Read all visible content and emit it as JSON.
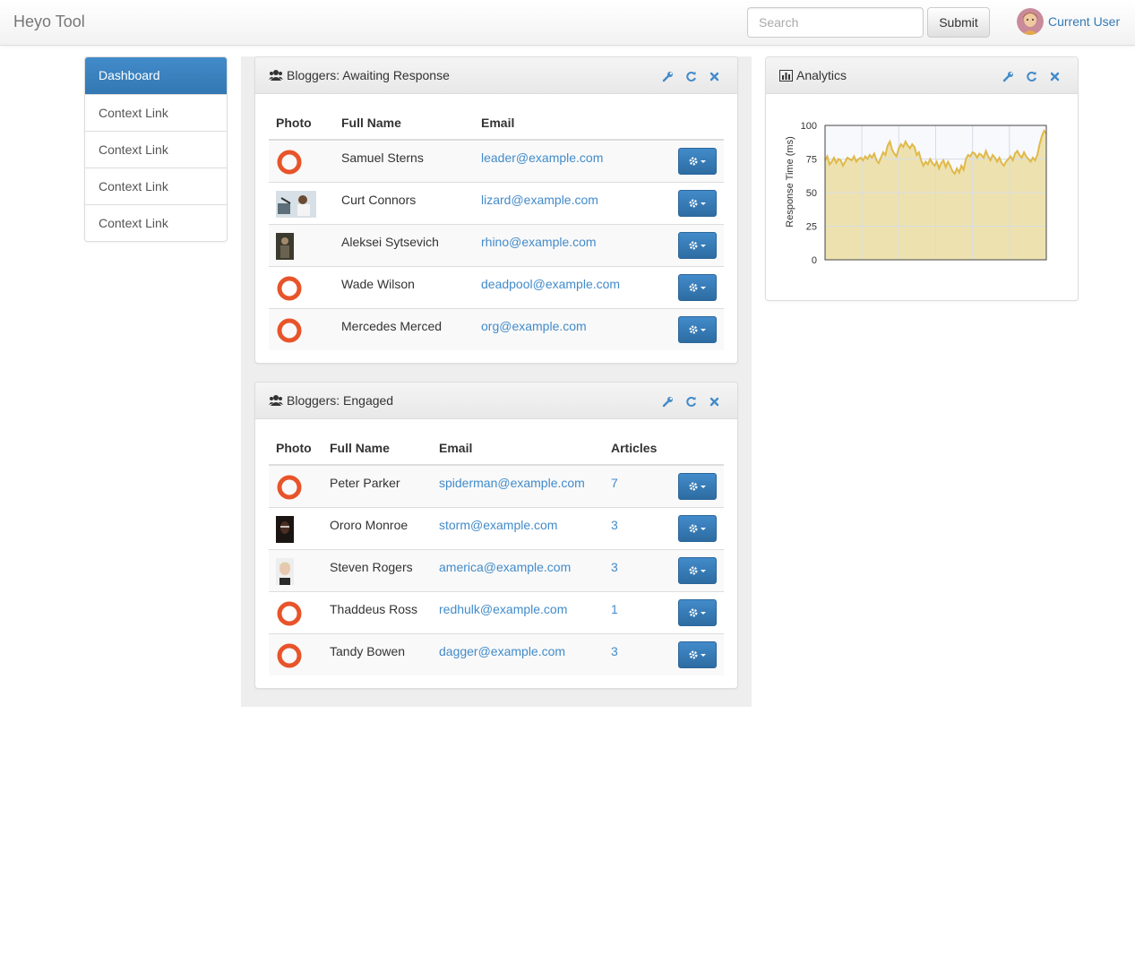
{
  "navbar": {
    "brand": "Heyo Tool",
    "search_placeholder": "Search",
    "submit_label": "Submit",
    "user_name": "Current User"
  },
  "sidebar": {
    "items": [
      {
        "label": "Dashboard",
        "active": true
      },
      {
        "label": "Context Link",
        "active": false
      },
      {
        "label": "Context Link",
        "active": false
      },
      {
        "label": "Context Link",
        "active": false
      },
      {
        "label": "Context Link",
        "active": false
      }
    ]
  },
  "awaiting": {
    "title": "Bloggers: Awaiting Response",
    "headers": [
      "Photo",
      "Full Name",
      "Email"
    ],
    "rows": [
      {
        "photo": "orange-ring-icon",
        "name": "Samuel Sterns",
        "email": "leader@example.com"
      },
      {
        "photo": "photo-image",
        "name": "Curt Connors",
        "email": "lizard@example.com"
      },
      {
        "photo": "photo-image",
        "name": "Aleksei Sytsevich",
        "email": "rhino@example.com"
      },
      {
        "photo": "orange-ring-icon",
        "name": "Wade Wilson",
        "email": "deadpool@example.com"
      },
      {
        "photo": "orange-ring-icon",
        "name": "Mercedes Merced",
        "email": "org@example.com"
      }
    ]
  },
  "engaged": {
    "title": "Bloggers: Engaged",
    "headers": [
      "Photo",
      "Full Name",
      "Email",
      "Articles"
    ],
    "rows": [
      {
        "photo": "orange-ring-icon",
        "name": "Peter Parker",
        "email": "spiderman@example.com",
        "articles": "7"
      },
      {
        "photo": "photo-image",
        "name": "Ororo Monroe",
        "email": "storm@example.com",
        "articles": "3"
      },
      {
        "photo": "photo-image",
        "name": "Steven Rogers",
        "email": "america@example.com",
        "articles": "3"
      },
      {
        "photo": "orange-ring-icon",
        "name": "Thaddeus Ross",
        "email": "redhulk@example.com",
        "articles": "1"
      },
      {
        "photo": "orange-ring-icon",
        "name": "Tandy Bowen",
        "email": "dagger@example.com",
        "articles": "3"
      }
    ]
  },
  "analytics": {
    "title": "Analytics"
  },
  "icons": {
    "panel_tools": [
      "wrench-icon",
      "refresh-icon",
      "close-icon"
    ],
    "row_action": "gear-icon"
  },
  "colors": {
    "primary": "#428bca",
    "ring": "#e8542a",
    "chart_line": "#e0b94a",
    "chart_fill": "#ebdfa6"
  },
  "chart_data": {
    "type": "area",
    "title": "",
    "xlabel": "",
    "ylabel": "Response Time (ms)",
    "ylim": [
      0,
      100
    ],
    "yticks": [
      0,
      25,
      50,
      75,
      100
    ],
    "grid": true,
    "x": [
      0,
      1,
      2,
      3,
      4,
      5,
      6,
      7,
      8,
      9,
      10,
      11,
      12,
      13,
      14,
      15,
      16,
      17,
      18,
      19,
      20,
      21,
      22,
      23,
      24,
      25,
      26,
      27,
      28,
      29,
      30,
      31,
      32,
      33,
      34,
      35,
      36,
      37,
      38,
      39,
      40,
      41,
      42,
      43,
      44,
      45,
      46,
      47,
      48,
      49,
      50,
      51,
      52,
      53,
      54,
      55,
      56,
      57,
      58,
      59,
      60,
      61,
      62,
      63,
      64,
      65,
      66,
      67,
      68,
      69,
      70,
      71,
      72,
      73,
      74,
      75,
      76,
      77,
      78,
      79,
      80,
      81,
      82,
      83,
      84,
      85,
      86,
      87,
      88,
      89,
      90,
      91,
      92,
      93,
      94,
      95,
      96,
      97,
      98,
      99
    ],
    "values": [
      74,
      77,
      71,
      73,
      76,
      72,
      75,
      74,
      70,
      73,
      76,
      75,
      74,
      77,
      73,
      75,
      76,
      74,
      77,
      75,
      78,
      76,
      79,
      74,
      72,
      76,
      80,
      78,
      85,
      88,
      82,
      79,
      77,
      83,
      86,
      84,
      88,
      85,
      83,
      86,
      84,
      78,
      80,
      74,
      70,
      73,
      71,
      75,
      72,
      70,
      73,
      68,
      72,
      74,
      69,
      73,
      70,
      66,
      64,
      68,
      65,
      70,
      67,
      75,
      78,
      77,
      80,
      79,
      76,
      79,
      78,
      76,
      81,
      77,
      74,
      78,
      76,
      73,
      76,
      72,
      70,
      73,
      75,
      77,
      74,
      79,
      81,
      78,
      76,
      80,
      77,
      75,
      73,
      76,
      74,
      78,
      86,
      92,
      96,
      94
    ]
  }
}
